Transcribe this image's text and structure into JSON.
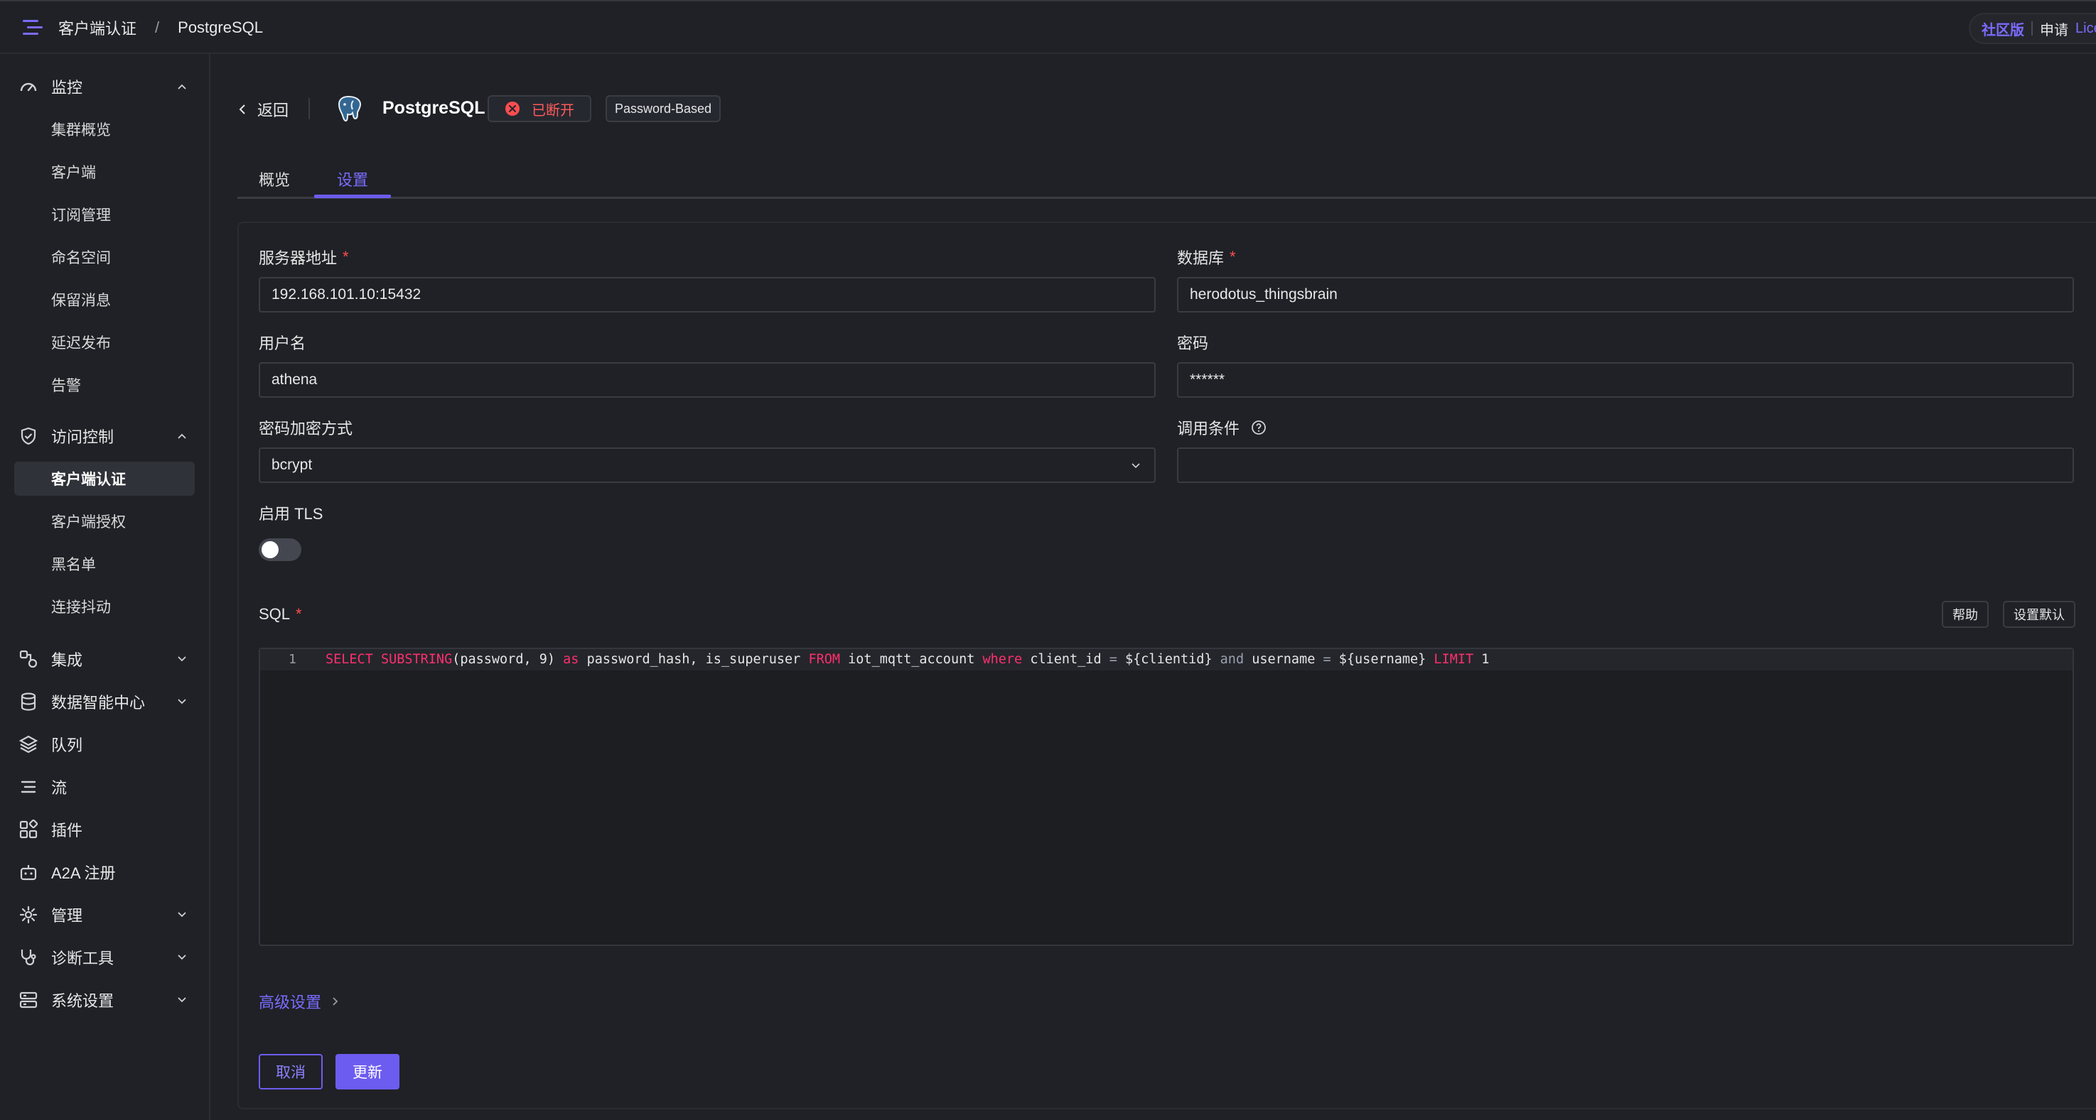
{
  "breadcrumb": {
    "items": [
      "客户端认证",
      "PostgreSQL"
    ],
    "separator": "/"
  },
  "edition": {
    "community": "社区版",
    "apply": "申请",
    "license": "Lice"
  },
  "sidebar": {
    "monitor": {
      "label": "监控",
      "items": [
        "集群概览",
        "客户端",
        "订阅管理",
        "命名空间",
        "保留消息",
        "延迟发布",
        "告警"
      ]
    },
    "access": {
      "label": "访问控制",
      "items": [
        "客户端认证",
        "客户端授权",
        "黑名单",
        "连接抖动"
      ],
      "active": "客户端认证"
    },
    "groups": [
      "集成",
      "数据智能中心",
      "队列",
      "流",
      "插件",
      "A2A 注册",
      "管理",
      "诊断工具",
      "系统设置"
    ]
  },
  "header": {
    "back_label": "返回",
    "title": "PostgreSQL",
    "status": "已断开",
    "mechanism": "Password-Based"
  },
  "tabs": [
    "概览",
    "设置"
  ],
  "form": {
    "server_label": "服务器地址",
    "server_value": "192.168.101.10:15432",
    "database_label": "数据库",
    "database_value": "herodotus_thingsbrain",
    "username_label": "用户名",
    "username_value": "athena",
    "password_label": "密码",
    "password_value": "******",
    "hash_label": "密码加密方式",
    "hash_value": "bcrypt",
    "precondition_label": "调用条件",
    "precondition_value": "",
    "tls_label": "启用 TLS",
    "tls_enabled": false,
    "sql_label": "SQL",
    "help_button": "帮助",
    "default_button": "设置默认",
    "required_mark": "*"
  },
  "sql_editor": {
    "line_number": "1",
    "tokens": [
      {
        "t": "SELECT",
        "c": "kw"
      },
      {
        "t": " ",
        "c": ""
      },
      {
        "t": "SUBSTRING",
        "c": "fn"
      },
      {
        "t": "(password, 9) ",
        "c": ""
      },
      {
        "t": "as",
        "c": "kw"
      },
      {
        "t": " password_hash, is_superuser ",
        "c": ""
      },
      {
        "t": "FROM",
        "c": "kw"
      },
      {
        "t": " iot_mqtt_account ",
        "c": ""
      },
      {
        "t": "where",
        "c": "kw"
      },
      {
        "t": " client_id ",
        "c": ""
      },
      {
        "t": "=",
        "c": "op"
      },
      {
        "t": " ${clientid} ",
        "c": ""
      },
      {
        "t": "and",
        "c": "op"
      },
      {
        "t": " username ",
        "c": ""
      },
      {
        "t": "=",
        "c": "op"
      },
      {
        "t": " ${username} ",
        "c": ""
      },
      {
        "t": "LIMIT",
        "c": "kw"
      },
      {
        "t": " 1",
        "c": ""
      }
    ]
  },
  "advanced_label": "高级设置",
  "actions": {
    "cancel": "取消",
    "update": "更新"
  },
  "colors": {
    "accent": "#6d5cf0",
    "danger": "#ff4d4f",
    "background": "#1f2126"
  },
  "icons": {
    "menu": "menu-icon",
    "monitor": "gauge-icon",
    "access": "shield-check-icon",
    "integration": "nodes-icon",
    "data": "database-icon",
    "queue": "layers-icon",
    "stream": "list-icon",
    "plugin": "puzzle-icon",
    "a2a": "robot-icon",
    "manage": "gear-icon",
    "diagnose": "stethoscope-icon",
    "system": "server-icon"
  }
}
